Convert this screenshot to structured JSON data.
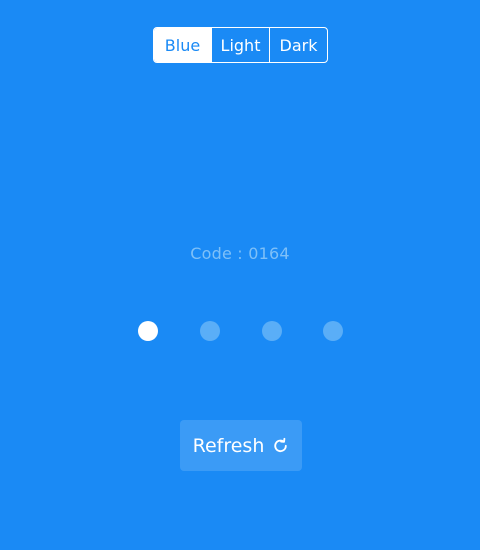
{
  "theme_switcher": {
    "options": [
      "Blue",
      "Light",
      "Dark"
    ],
    "selected": "Blue"
  },
  "code": {
    "text": "Code : 0164"
  },
  "pin_indicator": {
    "total_dots": 4,
    "filled_dots": 1
  },
  "refresh_button": {
    "label": "Refresh",
    "icon": "refresh-icon"
  },
  "colors": {
    "background": "#1a8af5",
    "accent": "#ffffff",
    "muted_text": "#7ec0f8",
    "dot_empty": "#5aaef7",
    "button_bg": "#3b9bf6"
  }
}
